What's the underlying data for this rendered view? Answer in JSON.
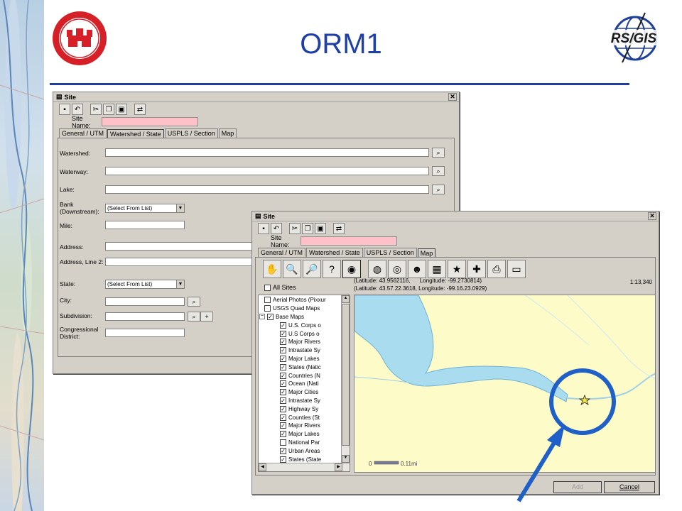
{
  "slide": {
    "title": "ORM1",
    "logos": {
      "left": "U.S. Army Corps of Engineers CERL seal",
      "right": "RS/GIS"
    }
  },
  "site_window_back": {
    "title": "Site",
    "site_name_label": "Site Name:",
    "tabs": [
      "General / UTM",
      "Watershed / State",
      "USPLS / Section",
      "Map"
    ],
    "active_tab": "Watershed / State",
    "fields": {
      "watershed": "Watershed:",
      "waterway": "Waterway:",
      "lake": "Lake:",
      "bank": "Bank (Downstream):",
      "bank_value": "(Select From List)",
      "mile": "Mile:",
      "address": "Address:",
      "address2": "Address, Line 2:",
      "state": "State:",
      "state_value": "(Select From List)",
      "city": "City:",
      "subdivision": "Subdivision:",
      "congressional": "Congressional District:"
    }
  },
  "site_window_front": {
    "title": "Site",
    "site_name_label": "Site Name:",
    "tabs": [
      "General / UTM",
      "Watershed / State",
      "USPLS / Section",
      "Map"
    ],
    "active_tab": "Map",
    "map_tools": [
      "pan-hand-icon",
      "zoom-in-icon",
      "zoom-out-icon",
      "identify-icon",
      "full-extent-icon",
      "globe-icon",
      "globe-search-icon",
      "globe-person-icon",
      "layers-icon",
      "globe-star-icon",
      "add-layer-icon",
      "print-icon",
      "save-icon"
    ],
    "all_sites_label": "All Sites",
    "coords_line1": "(Latitude: 43.9562116,      Longitude: -99.2730814)",
    "coords_line2": "(Latitude: 43.57.22.3618, Longitude: -99.16.23.0929)",
    "scale": "1:13,340",
    "scalebar_start": "0",
    "scalebar_end": "0.11mi",
    "layers": [
      {
        "label": "Aerial Photos (Pixxur",
        "checked": false,
        "level": 1
      },
      {
        "label": "USGS Quad Maps",
        "checked": false,
        "level": 1
      },
      {
        "label": "Base Maps",
        "checked": true,
        "level": 1,
        "expander": "−"
      },
      {
        "label": "U.S. Corps o",
        "checked": true,
        "level": 2
      },
      {
        "label": "U.S Corps o",
        "checked": true,
        "level": 2
      },
      {
        "label": "Major Rivers",
        "checked": true,
        "level": 2
      },
      {
        "label": "Intrastate Sy",
        "checked": true,
        "level": 2
      },
      {
        "label": "Major Lakes",
        "checked": true,
        "level": 2
      },
      {
        "label": "States (Natic",
        "checked": true,
        "level": 2
      },
      {
        "label": "Countries (N",
        "checked": true,
        "level": 2
      },
      {
        "label": "Ocean (Nati",
        "checked": true,
        "level": 2
      },
      {
        "label": "Major Cities",
        "checked": true,
        "level": 2
      },
      {
        "label": "Intrastate Sy",
        "checked": true,
        "level": 2
      },
      {
        "label": "Highway Sy",
        "checked": true,
        "level": 2
      },
      {
        "label": "Counties (St",
        "checked": true,
        "level": 2
      },
      {
        "label": "Major Rivers",
        "checked": true,
        "level": 2
      },
      {
        "label": "Major Lakes",
        "checked": true,
        "level": 2
      },
      {
        "label": "National Par",
        "checked": false,
        "level": 2
      },
      {
        "label": "Urban Areas",
        "checked": true,
        "level": 2
      },
      {
        "label": "States (State",
        "checked": true,
        "level": 2
      }
    ],
    "buttons": {
      "add": "Add",
      "cancel": "Cancel"
    }
  },
  "colors": {
    "title_blue": "#1f3fa8",
    "rule_blue": "#1e3f9c",
    "map_land": "#fdfbc8",
    "map_water": "#a9dcef",
    "callout_blue": "#1f5fc8",
    "site_name_pink": "#ffc0c8"
  }
}
